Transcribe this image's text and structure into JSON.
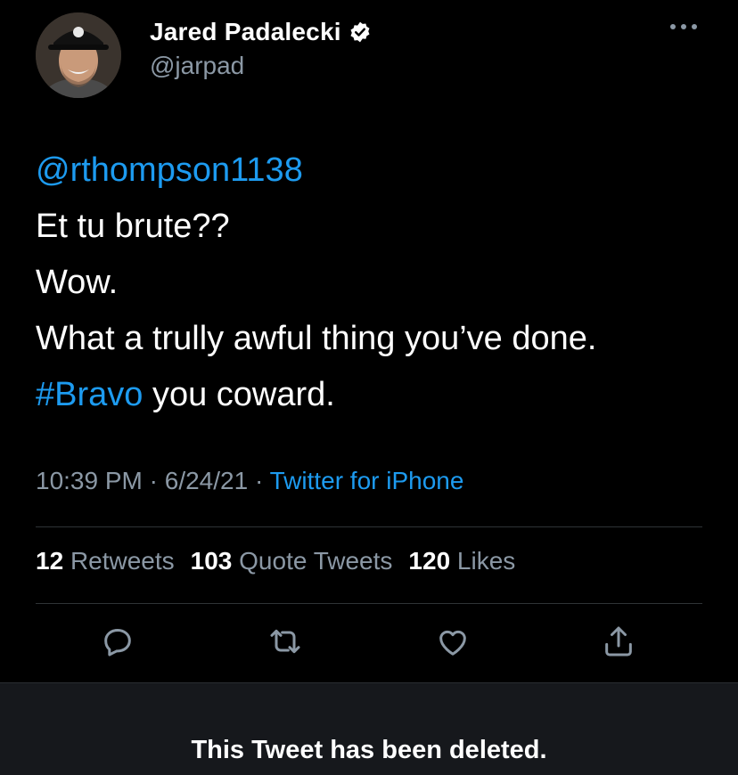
{
  "tweet": {
    "author": {
      "display_name": "Jared Padalecki",
      "handle": "@jarpad",
      "verified": true,
      "avatar_icon": "profile-photo"
    },
    "body_lines": [
      {
        "segments": [
          {
            "text": "@rthompson1138",
            "link": true
          }
        ]
      },
      {
        "segments": [
          {
            "text": "Et tu brute??",
            "link": false
          }
        ]
      },
      {
        "segments": [
          {
            "text": "Wow.",
            "link": false
          }
        ]
      },
      {
        "segments": [
          {
            "text": "What a trully awful thing you’ve done.",
            "link": false
          }
        ]
      },
      {
        "segments": [
          {
            "text": "#Bravo",
            "link": true
          },
          {
            "text": " you coward.",
            "link": false
          }
        ]
      }
    ],
    "meta": {
      "time": "10:39 PM",
      "date": "6/24/21",
      "separator": " · ",
      "source": "Twitter for iPhone"
    },
    "stats": {
      "retweets_count": "12",
      "retweets_label": "Retweets",
      "quote_count": "103",
      "quote_label": "Quote Tweets",
      "likes_count": "120",
      "likes_label": "Likes"
    },
    "actions": [
      "reply-icon",
      "retweet-icon",
      "like-icon",
      "share-icon"
    ]
  },
  "deleted_notice": "This Tweet has been deleted.",
  "colors": {
    "background": "#000000",
    "link": "#1d9bf0",
    "secondary_text": "#8b98a5",
    "divider": "#2f3336",
    "notice_background": "#16181c"
  }
}
